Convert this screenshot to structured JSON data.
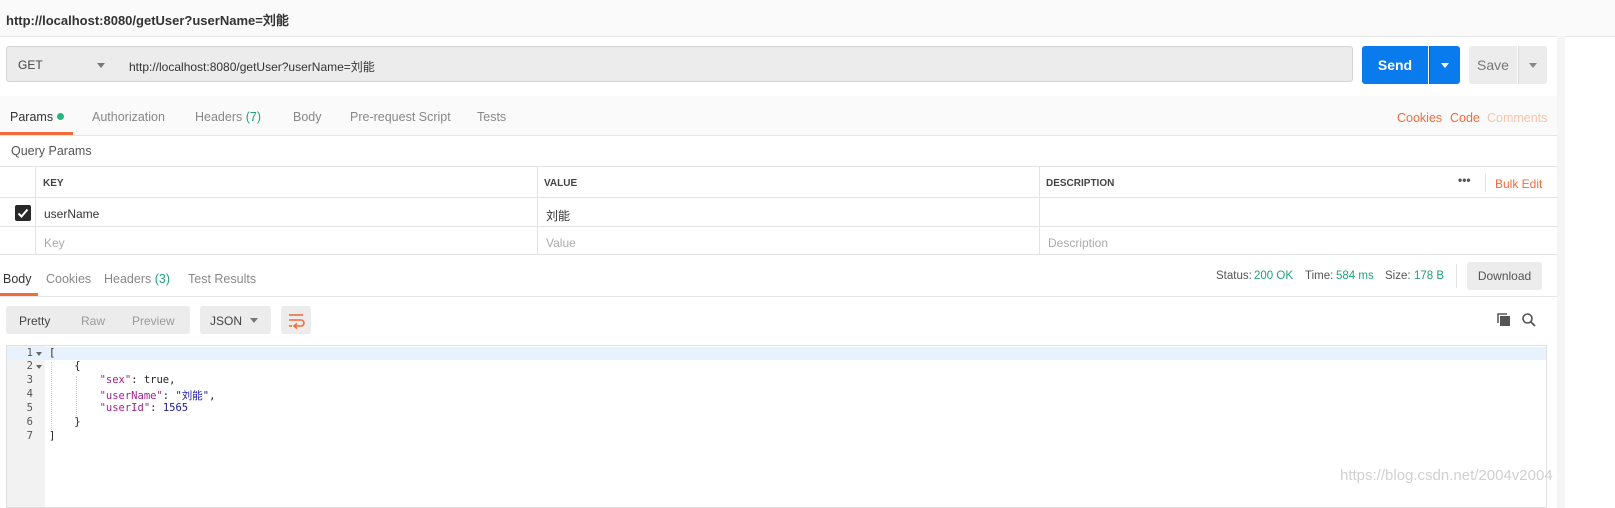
{
  "title": "http://localhost:8080/getUser?userName=刘能",
  "request": {
    "method": "GET",
    "url": "http://localhost:8080/getUser?userName=刘能",
    "send_label": "Send",
    "save_label": "Save"
  },
  "request_tabs": {
    "params": "Params",
    "authorization": "Authorization",
    "headers": "Headers",
    "headers_count": "(7)",
    "body": "Body",
    "prerequest": "Pre-request Script",
    "tests": "Tests",
    "cookies": "Cookies",
    "code": "Code",
    "comments": "Comments"
  },
  "query_params": {
    "label": "Query Params",
    "columns": [
      "KEY",
      "VALUE",
      "DESCRIPTION"
    ],
    "bulk_edit": "Bulk Edit",
    "more": "•••",
    "rows": [
      {
        "checked": true,
        "key": "userName",
        "value": "刘能",
        "description": ""
      }
    ],
    "placeholders": {
      "key": "Key",
      "value": "Value",
      "description": "Description"
    }
  },
  "response_tabs": {
    "body": "Body",
    "cookies": "Cookies",
    "headers": "Headers",
    "headers_count": "(3)",
    "test_results": "Test Results"
  },
  "response_status": {
    "status_label": "Status:",
    "status_value": "200 OK",
    "time_label": "Time:",
    "time_value": "584 ms",
    "size_label": "Size:",
    "size_value": "178 B",
    "download": "Download"
  },
  "response_toolbar": {
    "pretty": "Pretty",
    "raw": "Raw",
    "preview": "Preview",
    "format": "JSON"
  },
  "editor": {
    "line_numbers": [
      "1",
      "2",
      "3",
      "4",
      "5",
      "6",
      "7"
    ]
  },
  "watermark": "https://blog.csdn.net/2004v2004",
  "colors": {
    "accent": "#f26b3a",
    "send": "#097bed",
    "status_ok": "#21a07a"
  }
}
